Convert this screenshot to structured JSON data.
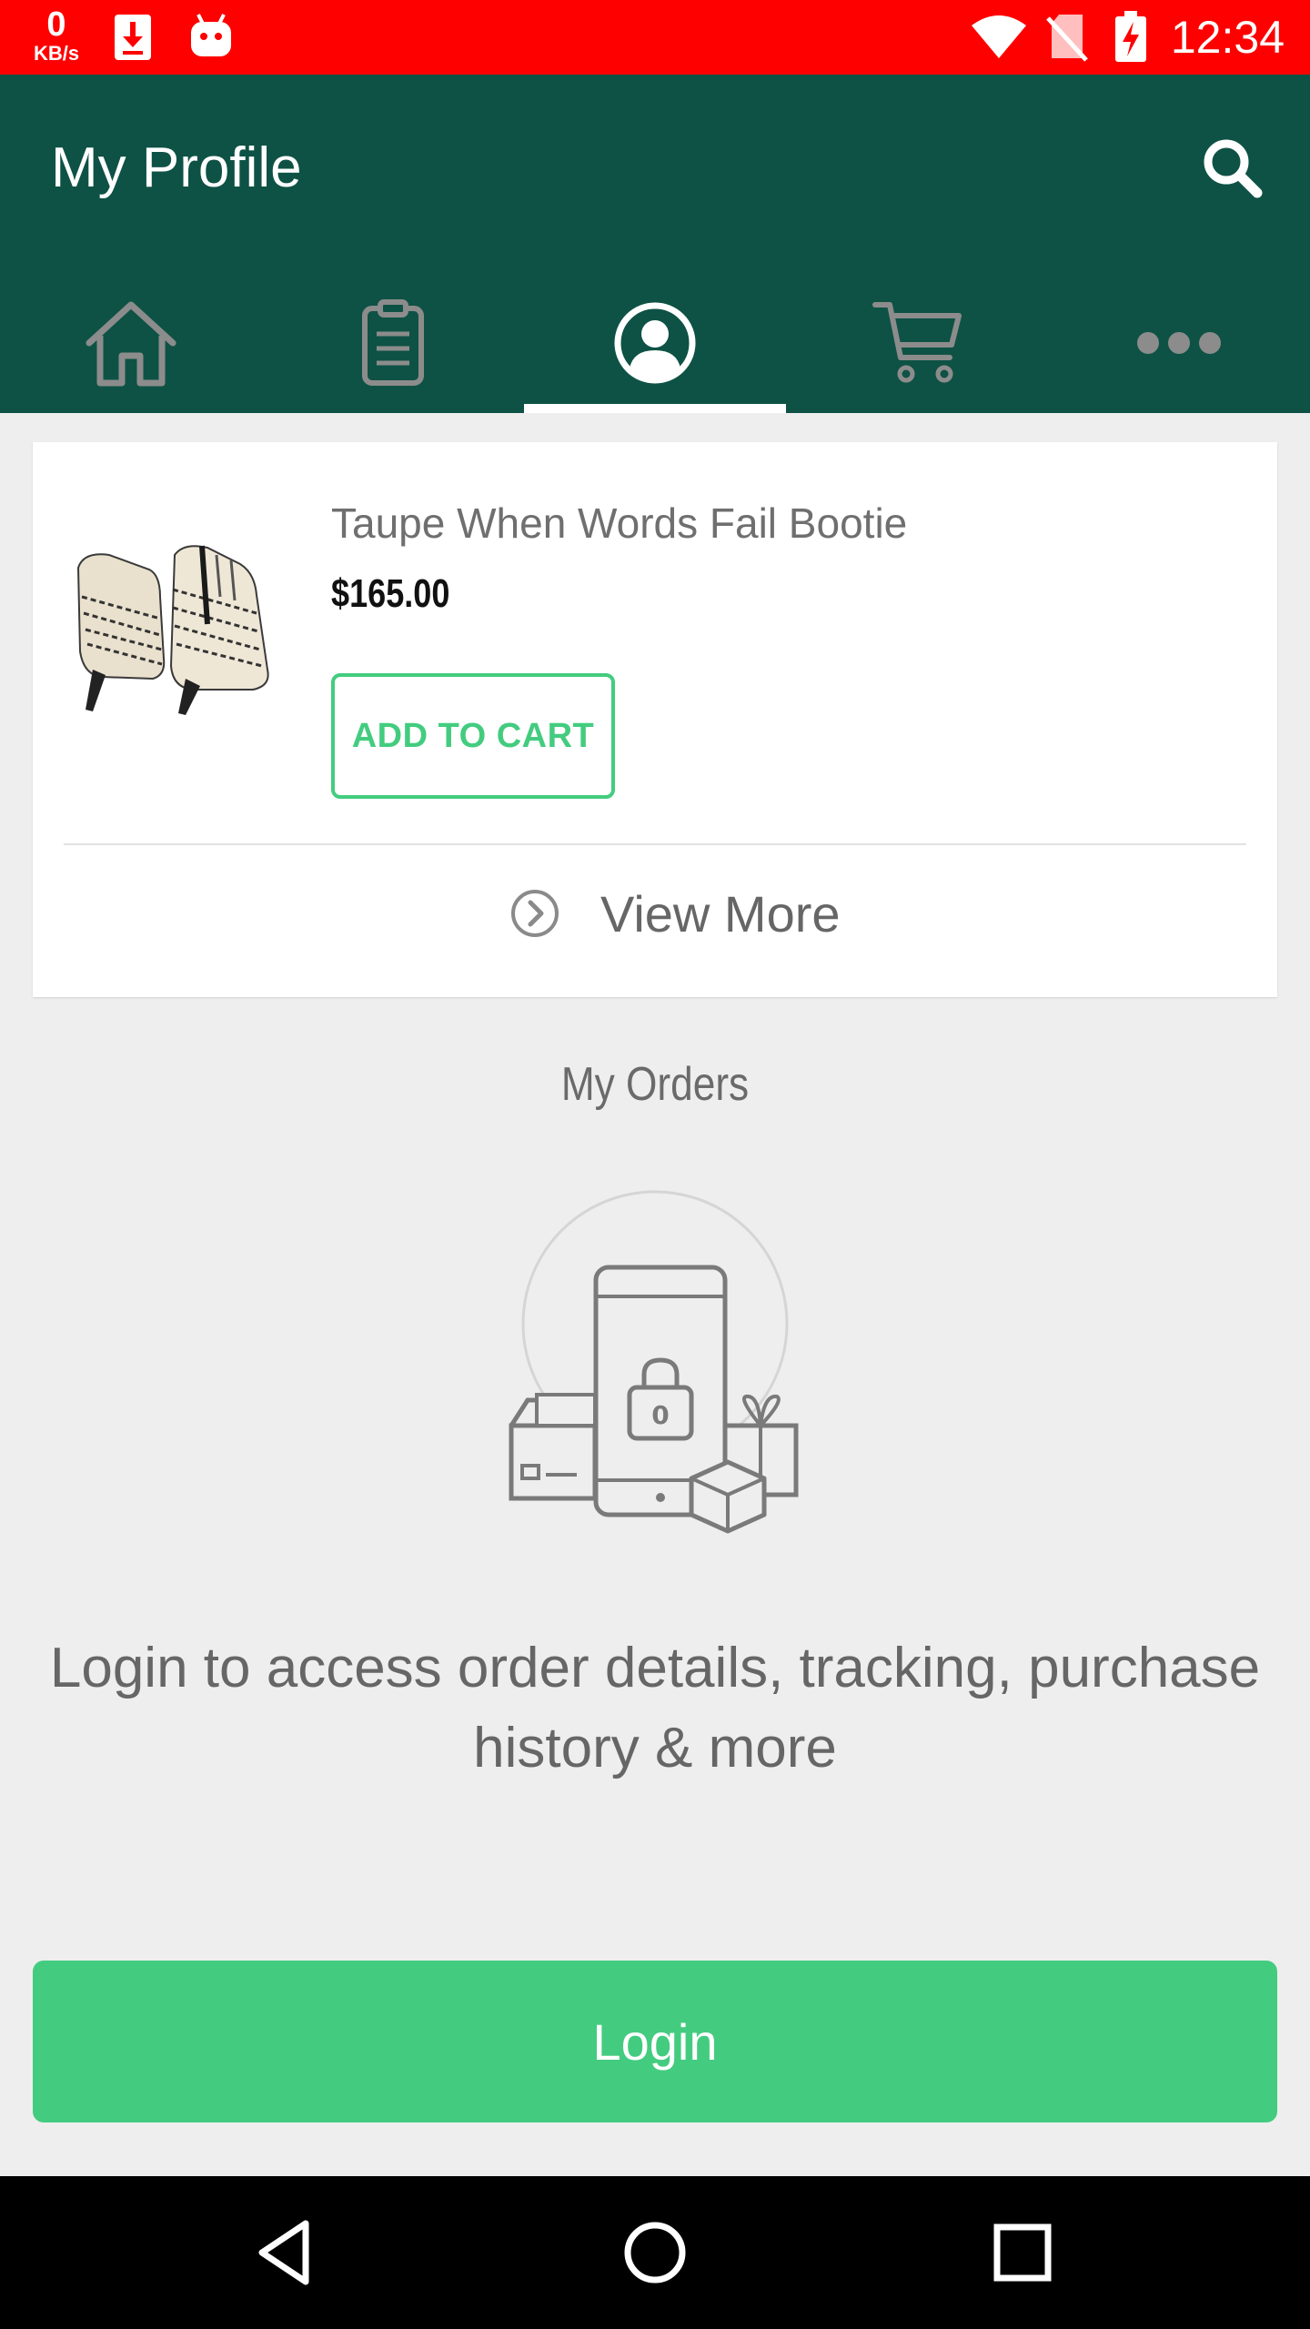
{
  "status_bar": {
    "speed_value": "0",
    "speed_unit": "KB/s",
    "time": "12:34",
    "icons": [
      "download-icon",
      "android-icon",
      "wifi-icon",
      "no-sim-icon",
      "battery-charging-icon"
    ],
    "background": "#ff0000"
  },
  "header": {
    "title": "My Profile",
    "search_icon": "search-icon",
    "background": "#0e5245"
  },
  "tabs": [
    {
      "name": "home",
      "icon": "home-icon",
      "selected": false
    },
    {
      "name": "orders",
      "icon": "clipboard-icon",
      "selected": false
    },
    {
      "name": "profile",
      "icon": "profile-icon",
      "selected": true
    },
    {
      "name": "cart",
      "icon": "cart-icon",
      "selected": false
    },
    {
      "name": "more",
      "icon": "more-icon",
      "selected": false
    }
  ],
  "product": {
    "name": "Taupe When Words Fail Bootie",
    "price": "$165.00",
    "add_to_cart_label": "ADD TO CART",
    "image": "product-image"
  },
  "view_more": {
    "label": "View More",
    "icon": "chevron-right-circle-icon"
  },
  "orders": {
    "heading": "My Orders",
    "illustration": "orders-illustration",
    "message": "Login to access order details, tracking, purchase history & more",
    "login_label": "Login"
  },
  "nav_bar": {
    "icons": [
      "back-icon",
      "home-circle-icon",
      "recents-icon"
    ]
  },
  "colors": {
    "accent_green": "#43cc7f",
    "header_green": "#0e5245",
    "background": "#eeeeee"
  }
}
